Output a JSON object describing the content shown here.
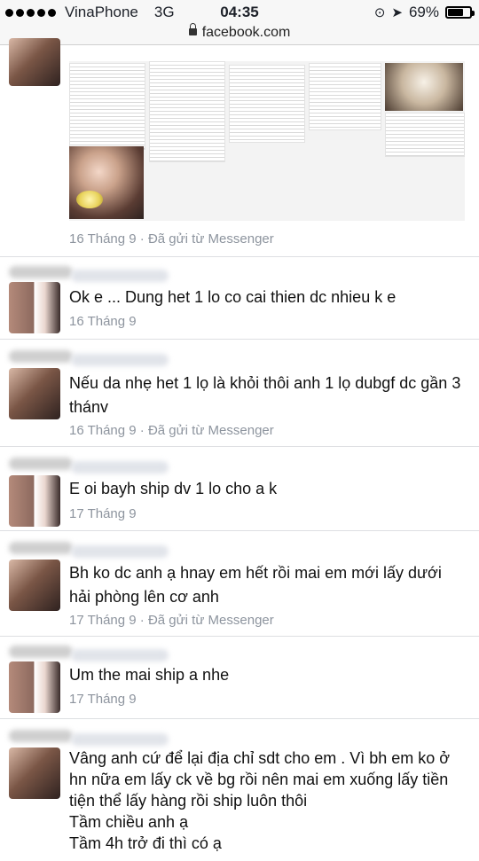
{
  "status_bar": {
    "carrier": "VinaPhone",
    "network": "3G",
    "time": "04:35",
    "battery": "69%"
  },
  "browser": {
    "url": "facebook.com"
  },
  "messages": [
    {
      "text": "",
      "date": "16 Tháng 9",
      "source": "· Đã gửi từ Messenger"
    },
    {
      "text": "Ok e ... Dung het 1 lo co cai thien dc nhieu k e",
      "date": "16 Tháng 9",
      "source": ""
    },
    {
      "text": "Nếu da nhẹ het 1 lọ là khỏi thôi anh 1 lọ dubgf dc gần 3 thánv",
      "date": "16 Tháng 9",
      "source": "· Đã gửi từ Messenger"
    },
    {
      "text": "E oi bayh ship dv 1 lo cho a k",
      "date": "17 Tháng 9",
      "source": ""
    },
    {
      "text": "Bh ko dc anh ạ hnay em hết rồi mai em mới lấy dưới hải phòng lên cơ anh",
      "date": "17 Tháng 9",
      "source": "· Đã gửi từ Messenger"
    },
    {
      "text": "Um the mai ship a nhe",
      "date": "17 Tháng 9",
      "source": ""
    },
    {
      "text": "Vâng anh cứ để lại địa chỉ sdt cho em . Vì bh em ko ở hn nữa em lấy ck về bg rồi nên mai em xuống lấy tiền tiện thể lấy hàng rồi ship luôn thôi\nTầm chiều anh ạ\nTầm 4h trở đi thì có ạ",
      "date": "",
      "source": ""
    }
  ],
  "colors": {
    "meta_text": "#8d949e",
    "separator": "#dddfe2"
  }
}
